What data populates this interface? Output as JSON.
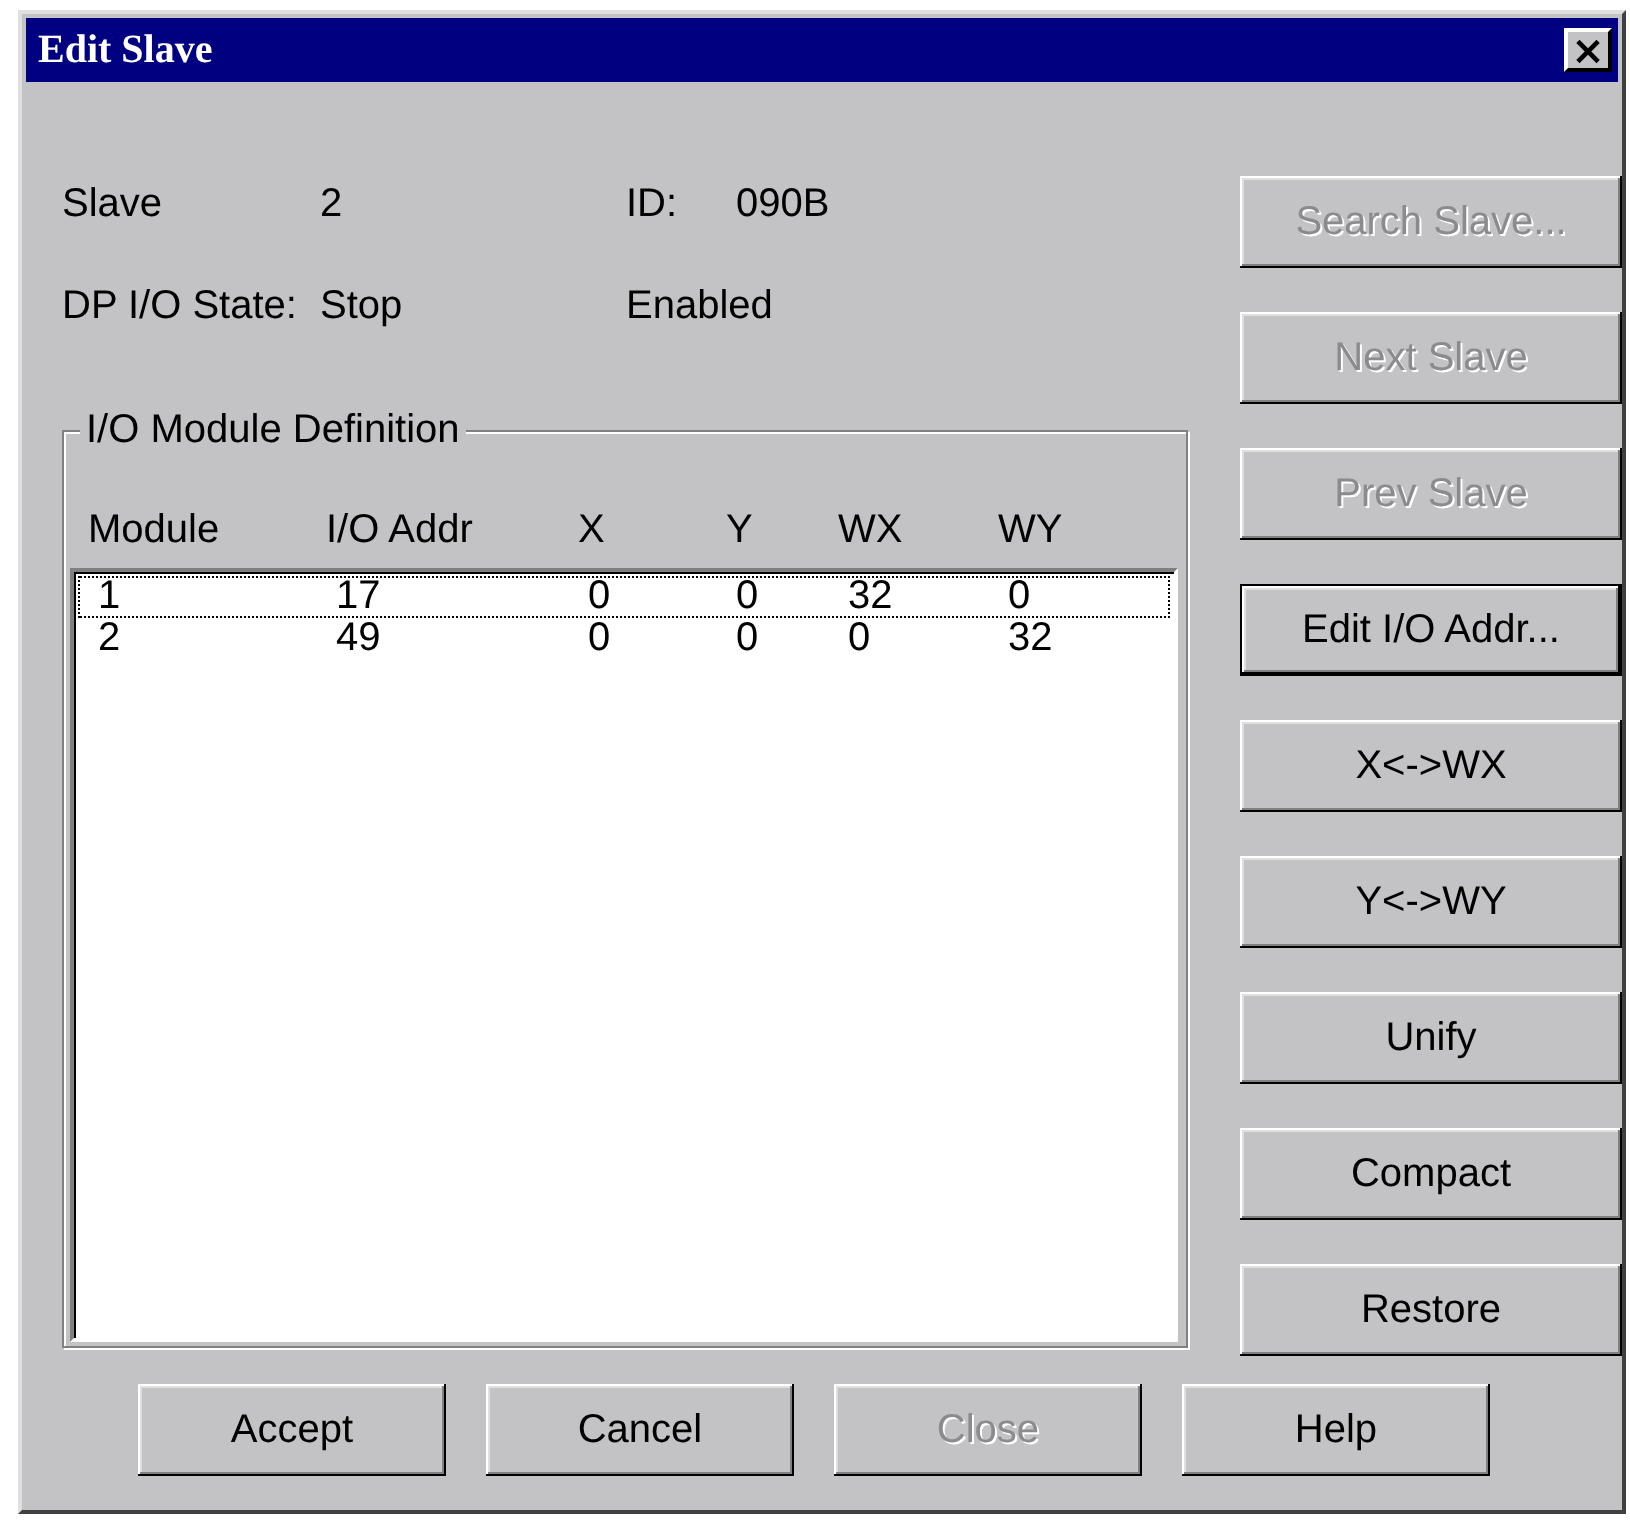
{
  "window": {
    "title": "Edit Slave",
    "close_label": "×"
  },
  "info": [
    {
      "label": "Slave",
      "value": "2",
      "label2": "ID:",
      "value2": "090B"
    },
    {
      "label": "DP I/O State:",
      "value": "Stop",
      "value2": "Enabled"
    }
  ],
  "group": {
    "title": "I/O Module Definition",
    "columns": [
      "Module",
      "I/O Addr",
      "X",
      "Y",
      "WX",
      "WY"
    ],
    "rows": [
      {
        "cells": [
          "1",
          "17",
          "0",
          "0",
          "32",
          "0"
        ],
        "focused": true
      },
      {
        "cells": [
          "2",
          "49",
          "0",
          "0",
          "0",
          "32"
        ],
        "focused": false
      }
    ]
  },
  "side_buttons": [
    {
      "label": "Search Slave...",
      "disabled": true,
      "default": false
    },
    {
      "label": "Next Slave",
      "disabled": true,
      "default": false
    },
    {
      "label": "Prev Slave",
      "disabled": true,
      "default": false
    },
    {
      "label": "Edit I/O Addr...",
      "disabled": false,
      "default": true
    },
    {
      "label": "X<->WX",
      "disabled": false,
      "default": false
    },
    {
      "label": "Y<->WY",
      "disabled": false,
      "default": false
    },
    {
      "label": "Unify",
      "disabled": false,
      "default": false
    },
    {
      "label": "Compact",
      "disabled": false,
      "default": false
    },
    {
      "label": "Restore",
      "disabled": false,
      "default": false
    }
  ],
  "bottom_buttons": [
    {
      "label": "Accept",
      "disabled": false,
      "default": false
    },
    {
      "label": "Cancel",
      "disabled": false,
      "default": false
    },
    {
      "label": "Close",
      "disabled": true,
      "default": false
    },
    {
      "label": "Help",
      "disabled": false,
      "default": false
    }
  ]
}
